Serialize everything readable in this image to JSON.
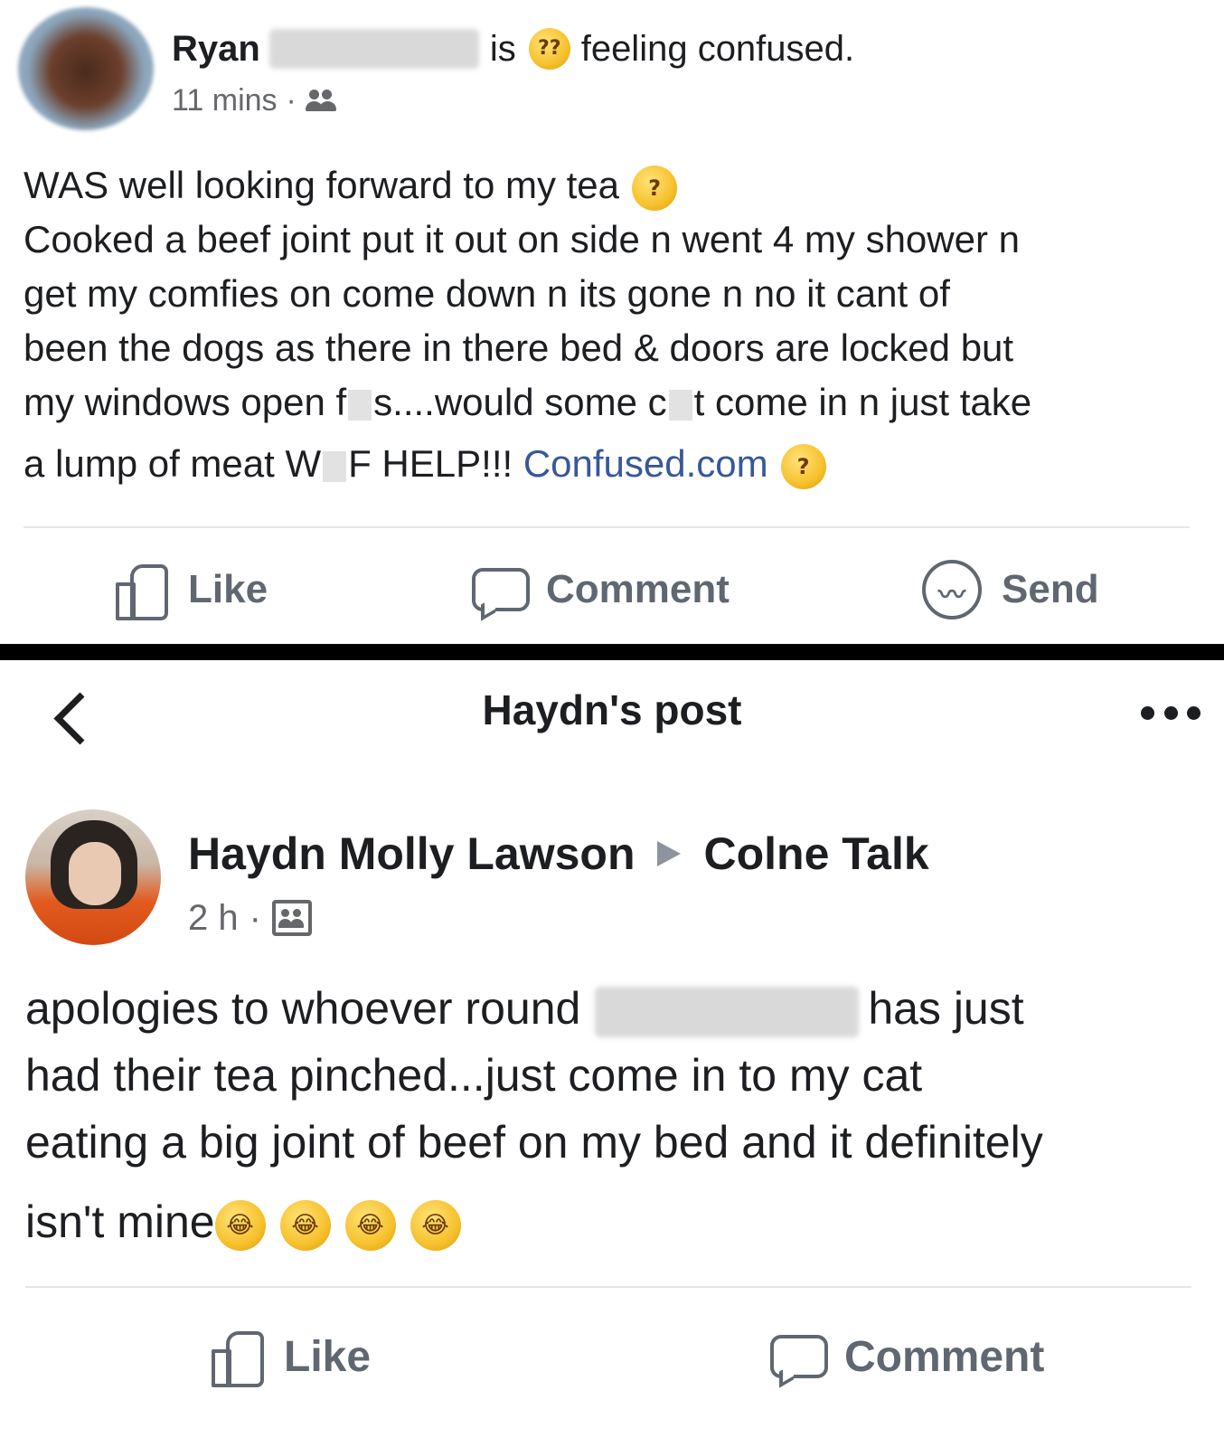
{
  "post1": {
    "author_first_name": "Ryan",
    "activity_is": "is",
    "feeling_emoji": "??",
    "feeling_text": "feeling confused.",
    "time": "11 mins",
    "separator": "·",
    "body_lines": [
      "WAS well looking forward to my tea",
      "Cooked a beef joint put it out on side n went 4 my shower n",
      "get my comfies on come down n its gone n no it cant of",
      "been the dogs as there in there bed & doors are locked but"
    ],
    "line5_a": "my windows open f",
    "line5_b": "s....would some c",
    "line5_c": "t come in n just take",
    "line6_a": "a lump of meat W",
    "line6_b": "F HELP!!! ",
    "link_text": "Confused.com",
    "think_emoji": "?",
    "actions": {
      "like": "Like",
      "comment": "Comment",
      "send": "Send"
    }
  },
  "post2": {
    "topbar_title": "Haydn's post",
    "author_name": "Haydn Molly Lawson",
    "group_name": "Colne Talk",
    "time": "2 h",
    "separator": "·",
    "line1_a": "apologies to whoever round",
    "line1_b": "has just",
    "line2": "had their tea pinched...just come in to my cat",
    "line3": "eating a big joint of beef on my bed and it definitely",
    "line4": "isn't mine",
    "laugh_emoji": "😂",
    "actions": {
      "like": "Like",
      "comment": "Comment"
    }
  }
}
